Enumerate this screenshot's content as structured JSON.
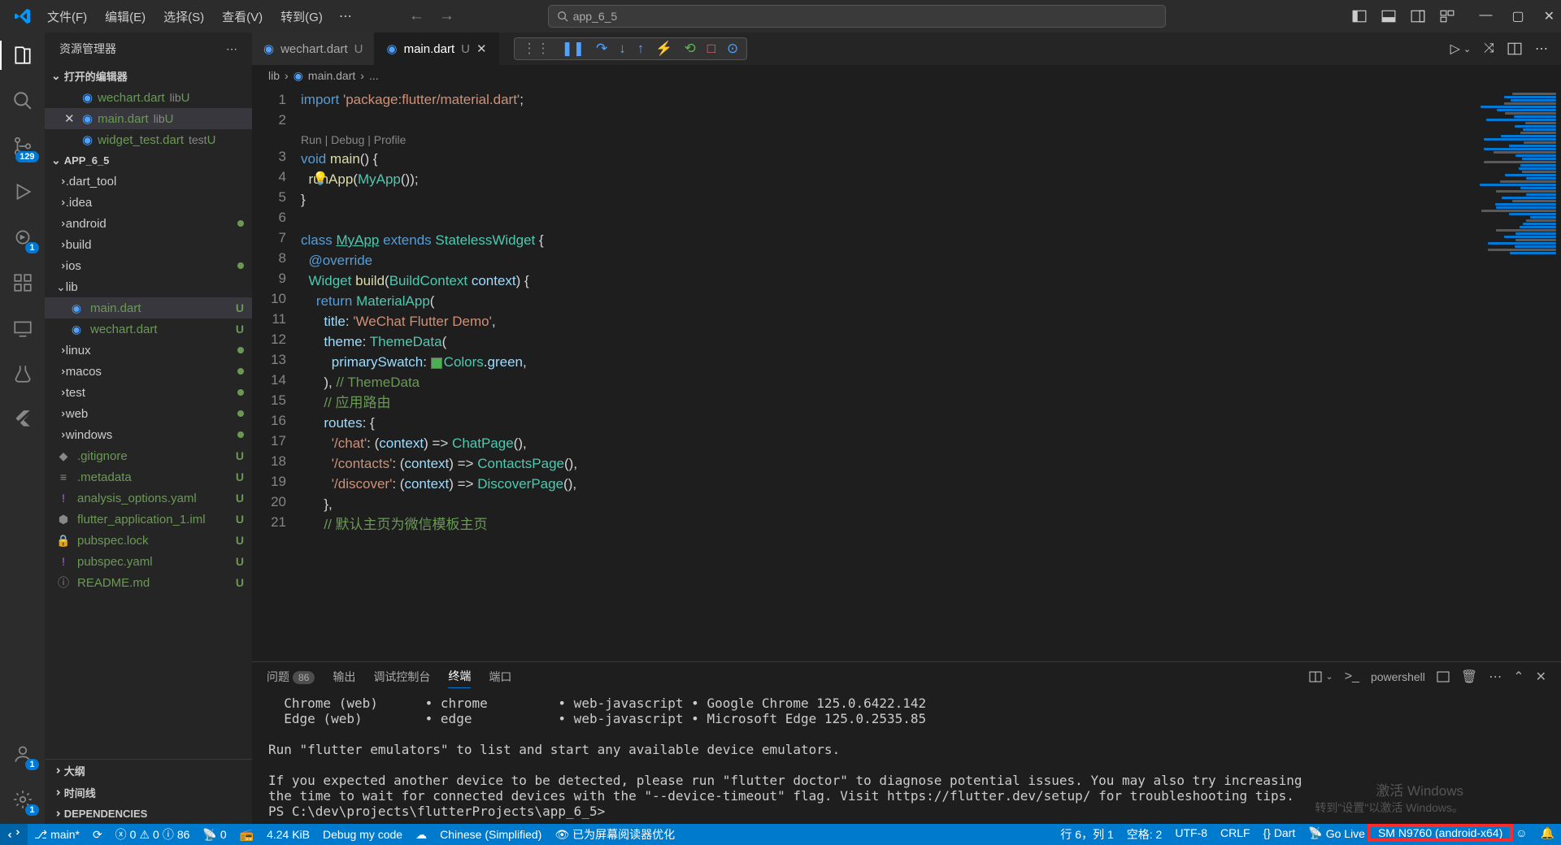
{
  "menu": [
    "文件(F)",
    "编辑(E)",
    "选择(S)",
    "查看(V)",
    "转到(G)"
  ],
  "search_text": "app_6_5",
  "sidebar": {
    "title": "资源管理器",
    "open_editors": "打开的编辑器",
    "project": "APP_6_5",
    "editors": [
      {
        "name": "wechart.dart",
        "meta": "lib",
        "status": "U",
        "active": false
      },
      {
        "name": "main.dart",
        "meta": "lib",
        "status": "U",
        "active": true
      },
      {
        "name": "widget_test.dart",
        "meta": "test",
        "status": "U",
        "active": false
      }
    ],
    "tree": [
      {
        "t": "folder",
        "name": ".dart_tool",
        "chev": "right"
      },
      {
        "t": "folder",
        "name": ".idea",
        "chev": "right"
      },
      {
        "t": "folder",
        "name": "android",
        "chev": "right",
        "dot": true
      },
      {
        "t": "folder",
        "name": "build",
        "chev": "right"
      },
      {
        "t": "folder",
        "name": "ios",
        "chev": "right",
        "dot": true
      },
      {
        "t": "folder",
        "name": "lib",
        "chev": "down",
        "open": true
      },
      {
        "t": "file",
        "name": "main.dart",
        "status": "U",
        "sel": true,
        "indent": 1,
        "icon": "dart"
      },
      {
        "t": "file",
        "name": "wechart.dart",
        "status": "U",
        "indent": 1,
        "icon": "dart"
      },
      {
        "t": "folder",
        "name": "linux",
        "chev": "right",
        "dot": true
      },
      {
        "t": "folder",
        "name": "macos",
        "chev": "right",
        "dot": true
      },
      {
        "t": "folder",
        "name": "test",
        "chev": "right",
        "dot": true
      },
      {
        "t": "folder",
        "name": "web",
        "chev": "right",
        "dot": true
      },
      {
        "t": "folder",
        "name": "windows",
        "chev": "right",
        "dot": true
      },
      {
        "t": "file",
        "name": ".gitignore",
        "status": "U",
        "icon": "git"
      },
      {
        "t": "file",
        "name": ".metadata",
        "status": "U",
        "icon": "meta"
      },
      {
        "t": "file",
        "name": "analysis_options.yaml",
        "status": "U",
        "icon": "yaml"
      },
      {
        "t": "file",
        "name": "flutter_application_1.iml",
        "status": "U",
        "icon": "iml"
      },
      {
        "t": "file",
        "name": "pubspec.lock",
        "status": "U",
        "icon": "lock"
      },
      {
        "t": "file",
        "name": "pubspec.yaml",
        "status": "U",
        "icon": "yaml"
      },
      {
        "t": "file",
        "name": "README.md",
        "status": "U",
        "icon": "md"
      }
    ],
    "bottom_sections": [
      "大纲",
      "时间线",
      "DEPENDENCIES"
    ]
  },
  "activity_badges": {
    "scm": "129",
    "debug": "1",
    "accounts": "1",
    "settings": "1"
  },
  "tabs": [
    {
      "name": "wechart.dart",
      "mod": "U",
      "active": false
    },
    {
      "name": "main.dart",
      "mod": "U",
      "active": true,
      "close": true
    }
  ],
  "breadcrumb": [
    "lib",
    "main.dart",
    "..."
  ],
  "codelens": "Run | Debug | Profile",
  "code_lines": [
    {
      "n": 1,
      "html": "<span class='k-blue'>import</span> <span class='k-str'>'package:flutter/material.dart'</span>;"
    },
    {
      "n": 2,
      "html": ""
    },
    {
      "codelens": true
    },
    {
      "n": 3,
      "html": "<span class='k-blue'>void</span> <span class='k-func'>main</span>() {"
    },
    {
      "n": 4,
      "html": "  <span class='k-func'>runApp</span>(<span class='k-type'>MyApp</span>());"
    },
    {
      "n": 5,
      "html": "}"
    },
    {
      "n": 6,
      "html": ""
    },
    {
      "n": 7,
      "html": "<span class='k-blue'>class</span> <span class='k-cls'>MyApp</span> <span class='k-blue'>extends</span> <span class='k-type'>StatelessWidget</span> {"
    },
    {
      "n": 8,
      "html": "  <span class='k-blue'>@override</span>"
    },
    {
      "n": 9,
      "html": "  <span class='k-type'>Widget</span> <span class='k-func'>build</span>(<span class='k-type'>BuildContext</span> <span class='k-var'>context</span>) {"
    },
    {
      "n": 10,
      "html": "    <span class='k-blue'>return</span> <span class='k-type'>MaterialApp</span>("
    },
    {
      "n": 11,
      "html": "      <span class='k-var'>title</span>: <span class='k-str'>'WeChat Flutter Demo'</span>,"
    },
    {
      "n": 12,
      "html": "      <span class='k-var'>theme</span>: <span class='k-type'>ThemeData</span>("
    },
    {
      "n": 13,
      "html": "        <span class='k-var'>primarySwatch</span>: <span class='colorbox'></span><span class='k-type'>Colors</span>.<span class='k-var'>green</span>,"
    },
    {
      "n": 14,
      "html": "      ), <span class='k-com'>// ThemeData</span>"
    },
    {
      "n": 15,
      "html": "      <span class='k-com'>// 应用路由</span>"
    },
    {
      "n": 16,
      "html": "      <span class='k-var'>routes</span>: {"
    },
    {
      "n": 17,
      "html": "        <span class='k-str'>'/chat'</span>: (<span class='k-var'>context</span>) =&gt; <span class='k-type'>ChatPage</span>(),"
    },
    {
      "n": 18,
      "html": "        <span class='k-str'>'/contacts'</span>: (<span class='k-var'>context</span>) =&gt; <span class='k-type'>ContactsPage</span>(),"
    },
    {
      "n": 19,
      "html": "        <span class='k-str'>'/discover'</span>: (<span class='k-var'>context</span>) =&gt; <span class='k-type'>DiscoverPage</span>(),"
    },
    {
      "n": 20,
      "html": "      },"
    },
    {
      "n": 21,
      "html": "      <span class='k-com'>// 默认主页为微信模板主页</span>"
    }
  ],
  "panel": {
    "tabs": [
      {
        "label": "问题",
        "count": "86"
      },
      {
        "label": "输出"
      },
      {
        "label": "调试控制台"
      },
      {
        "label": "终端",
        "active": true
      },
      {
        "label": "端口"
      }
    ],
    "term_label": "powershell",
    "terminal_lines": [
      "  Chrome (web)      • chrome         • web-javascript • Google Chrome 125.0.6422.142",
      "  Edge (web)        • edge           • web-javascript • Microsoft Edge 125.0.2535.85",
      "",
      "Run \"flutter emulators\" to list and start any available device emulators.",
      "",
      "If you expected another device to be detected, please run \"flutter doctor\" to diagnose potential issues. You may also try increasing",
      "the time to wait for connected devices with the \"--device-timeout\" flag. Visit https://flutter.dev/setup/ for troubleshooting tips.",
      "PS C:\\dev\\projects\\flutterProjects\\app_6_5> "
    ]
  },
  "watermark": {
    "l1": "激活 Windows",
    "l2": "转到\"设置\"以激活 Windows。"
  },
  "status": {
    "branch": "main*",
    "sync": "",
    "errors": "0",
    "warnings": "0",
    "info": "86",
    "port": "0",
    "radio": "",
    "size": "4.24 KiB",
    "debug": "Debug my code",
    "lang_server": "",
    "lang": "Chinese (Simplified)",
    "screen": "已为屏幕阅读器优化",
    "pos": "行 6，列 1",
    "spaces": "空格: 2",
    "encoding": "UTF-8",
    "eol": "CRLF",
    "mode": "{} Dart",
    "golive": "Go Live",
    "device": "SM N9760 (android-x64)"
  }
}
